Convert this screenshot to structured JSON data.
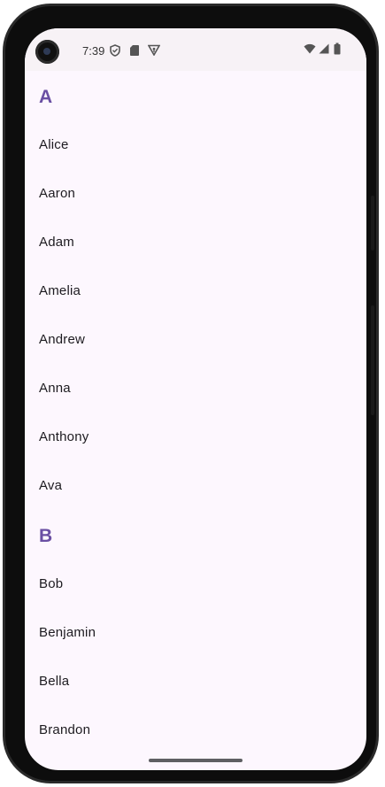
{
  "status_bar": {
    "time": "7:39",
    "left_icons": [
      "shield-icon",
      "sd-card-icon",
      "vpn-key-icon"
    ],
    "right_icons": [
      "wifi-icon",
      "cell-signal-icon",
      "battery-icon"
    ]
  },
  "sections": [
    {
      "header": "A",
      "items": [
        "Alice",
        "Aaron",
        "Adam",
        "Amelia",
        "Andrew",
        "Anna",
        "Anthony",
        "Ava"
      ]
    },
    {
      "header": "B",
      "items": [
        "Bob",
        "Benjamin",
        "Bella",
        "Brandon"
      ]
    }
  ],
  "colors": {
    "accent": "#6a4fa3",
    "background": "#fdf7fe",
    "text": "#1d1b20"
  }
}
